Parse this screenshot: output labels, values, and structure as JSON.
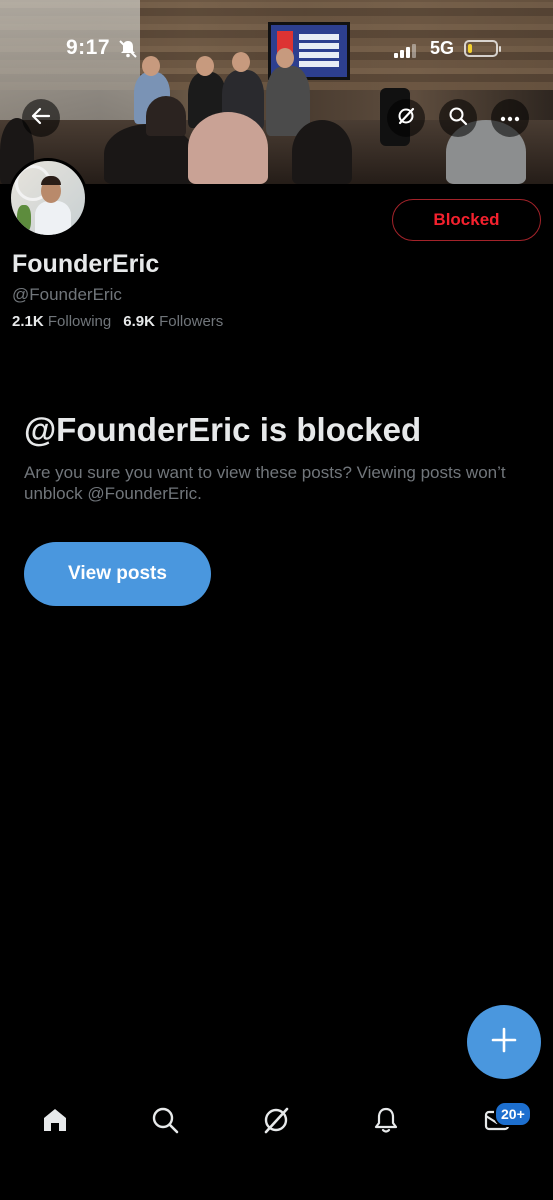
{
  "status_bar": {
    "time": "9:17",
    "network": "5G",
    "battery_level": 0.15,
    "battery_color": "#f3d130",
    "icons": [
      "bell-slash-icon",
      "cellular-signal-icon",
      "battery-icon"
    ]
  },
  "header": {
    "icons": [
      "back-arrow-icon",
      "grok-icon",
      "search-icon",
      "more-icon"
    ]
  },
  "profile": {
    "display_name": "FounderEric",
    "handle": "@FounderEric",
    "following_count": "2.1K",
    "following_label": "Following",
    "followers_count": "6.9K",
    "followers_label": "Followers",
    "blocked_button_label": "Blocked",
    "blocked_color": "#f4212e"
  },
  "blocked_notice": {
    "title": "@FounderEric is blocked",
    "description": "Are you sure you want to view these posts? Viewing posts won’t unblock @FounderEric.",
    "view_posts_label": "View posts",
    "accent": "#4a97de"
  },
  "compose": {
    "icon": "plus-icon"
  },
  "tabbar": {
    "items": [
      "home-icon",
      "search-icon",
      "grok-icon",
      "notifications-icon",
      "messages-icon"
    ],
    "messages_badge": "20+"
  }
}
